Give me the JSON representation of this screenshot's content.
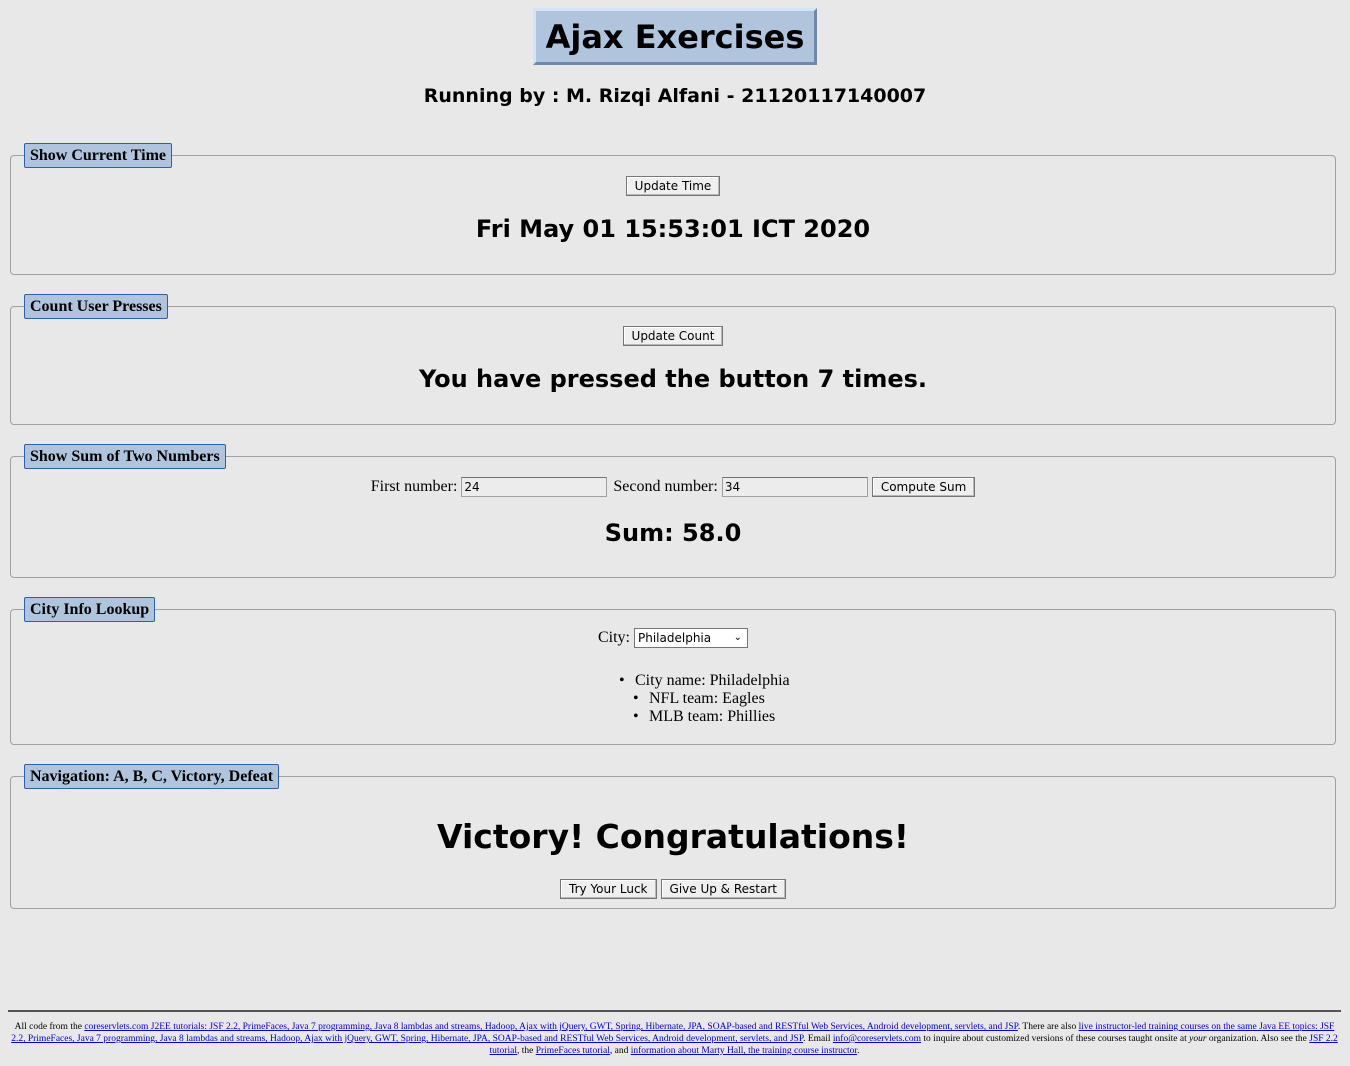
{
  "header": {
    "title": "Ajax Exercises",
    "subtitle": "Running by : M. Rizqi Alfani - 21120117140007"
  },
  "time_panel": {
    "legend": "Show Current Time",
    "button_label": "Update Time",
    "result": "Fri May 01 15:53:01 ICT 2020"
  },
  "count_panel": {
    "legend": "Count User Presses",
    "button_label": "Update Count",
    "result": "You have pressed the button 7 times."
  },
  "sum_panel": {
    "legend": "Show Sum of Two Numbers",
    "first_label": "First number:",
    "first_value": "24",
    "second_label": "Second number:",
    "second_value": "34",
    "button_label": "Compute Sum",
    "result": "Sum: 58.0"
  },
  "city_panel": {
    "legend": "City Info Lookup",
    "city_label": "City:",
    "selected_city": "Philadelphia",
    "info": [
      "City name: Philadelphia",
      "NFL team: Eagles",
      "MLB team: Phillies"
    ]
  },
  "nav_panel": {
    "legend": "Navigation: A, B, C, Victory, Defeat",
    "result": "Victory! Congratulations!",
    "try_button": "Try Your Luck",
    "restart_button": "Give Up & Restart"
  },
  "footer": {
    "t1": "All code from the ",
    "l1": "coreservlets.com J2EE tutorials: JSF 2.2, PrimeFaces, Java 7 programming, Java 8 lambdas and streams, Hadoop, Ajax with jQuery, GWT, Spring, Hibernate, JPA, SOAP-based and RESTful Web Services, Android development, servlets, and JSP",
    "t2": ". There are also ",
    "l2": "live instructor-led training courses on the same Java EE topics: JSF 2.2, PrimeFaces, Java 7 programming, Java 8 lambdas and streams, Hadoop, Ajax with jQuery, GWT, Spring, Hibernate, JPA, SOAP-based and RESTful Web Services, Android development, servlets, and JSP",
    "t3": ". Email ",
    "l3": "info@coreservlets.com",
    "t4": " to inquire about customized versions of these courses taught onsite at ",
    "t4_em": "your",
    "t5": " organization. Also see the ",
    "l4": "JSF 2.2 tutorial",
    "t6": ", the ",
    "l5": "PrimeFaces tutorial",
    "t7": ", and ",
    "l6": "information about Marty Hall, the training course instructor",
    "t8": "."
  }
}
